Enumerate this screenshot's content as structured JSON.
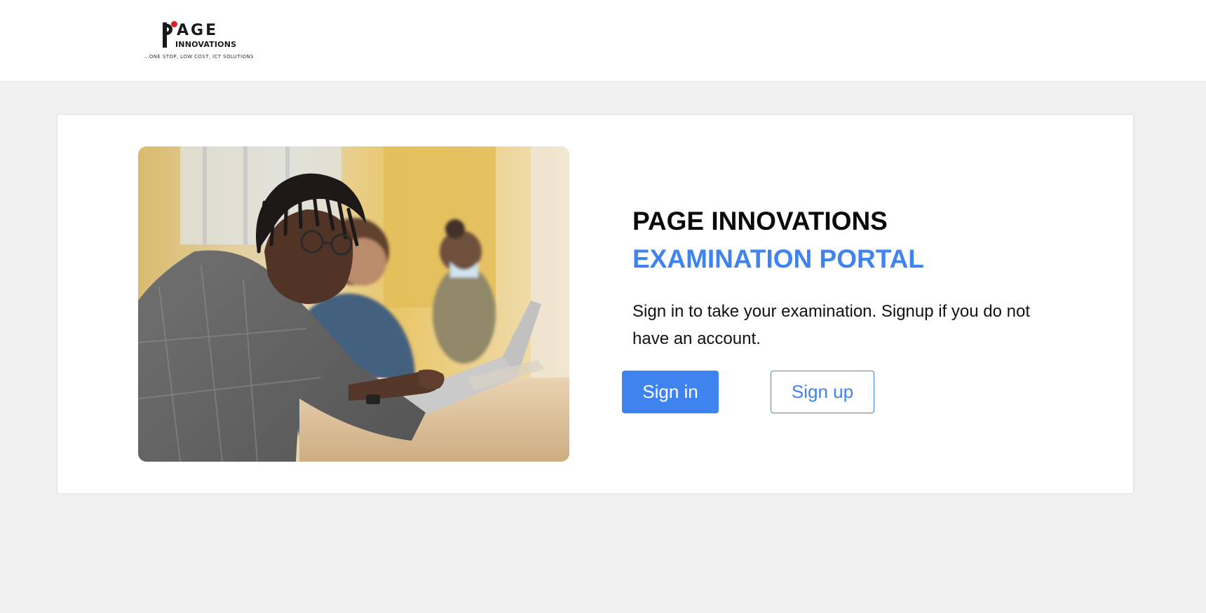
{
  "header": {
    "logo": {
      "brand_top": "AGE",
      "brand_bottom": "INNOVATIONS",
      "tagline": "...ONE STOP, LOW COST, ICT SOLUTIONS"
    }
  },
  "main": {
    "hero_image": {
      "alt": "Students working on laptops"
    },
    "title": "PAGE INNOVATIONS",
    "subtitle": "EXAMINATION PORTAL",
    "description": "Sign in to take your examination. Signup if you do not have an account.",
    "buttons": {
      "signin_label": "Sign in",
      "signup_label": "Sign up"
    }
  },
  "colors": {
    "accent": "#3f83ee",
    "brand_red": "#d9232a",
    "page_bg": "#f0f0f0"
  }
}
